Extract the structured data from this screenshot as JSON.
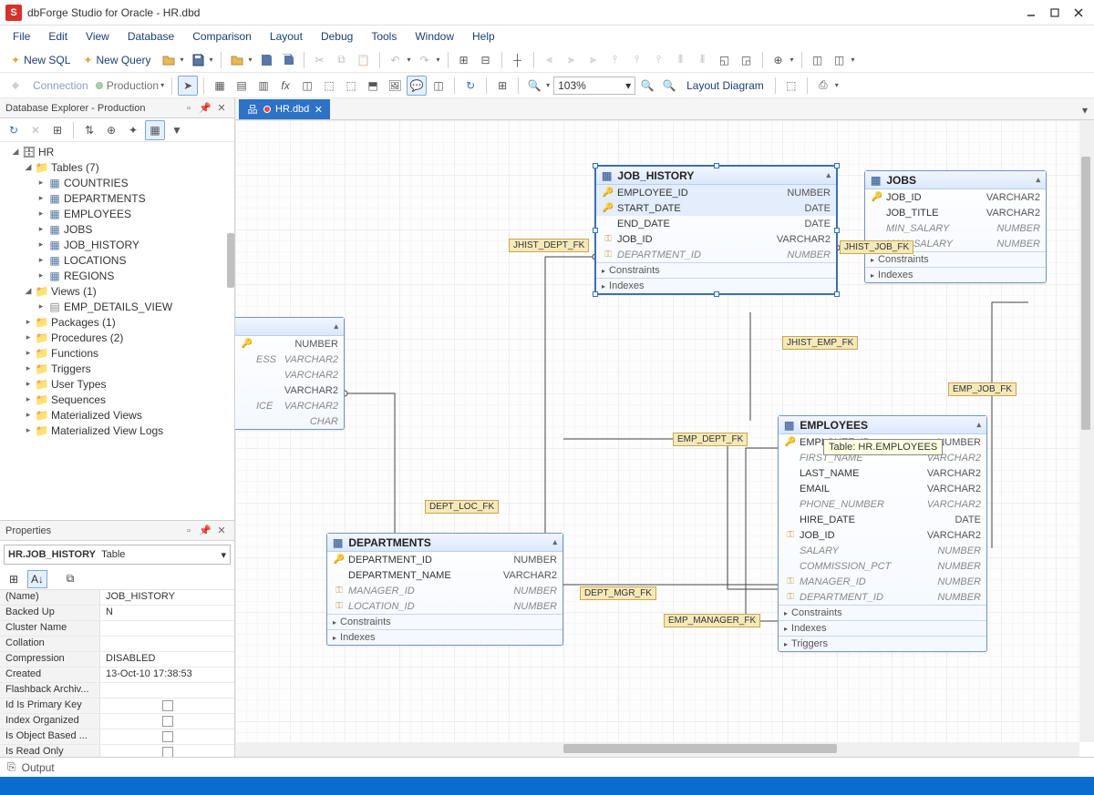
{
  "titlebar": {
    "title": "dbForge Studio for Oracle - HR.dbd"
  },
  "menu": [
    "File",
    "Edit",
    "View",
    "Database",
    "Comparison",
    "Layout",
    "Debug",
    "Tools",
    "Window",
    "Help"
  ],
  "toolbar1": {
    "newSql": "New SQL",
    "newQuery": "New Query"
  },
  "toolbar2": {
    "connection": "Connection",
    "production": "Production",
    "zoom": "103%",
    "layout": "Layout Diagram"
  },
  "dbExplorer": {
    "title": "Database Explorer - Production",
    "root": "HR",
    "tablesFolder": "Tables (7)",
    "tables": [
      "COUNTRIES",
      "DEPARTMENTS",
      "EMPLOYEES",
      "JOBS",
      "JOB_HISTORY",
      "LOCATIONS",
      "REGIONS"
    ],
    "viewsFolder": "Views (1)",
    "views": [
      "EMP_DETAILS_VIEW"
    ],
    "folders": [
      "Packages (1)",
      "Procedures (2)",
      "Functions",
      "Triggers",
      "User Types",
      "Sequences",
      "Materialized Views",
      "Materialized View Logs"
    ]
  },
  "properties": {
    "title": "Properties",
    "obj_name": "HR.JOB_HISTORY",
    "obj_type": "Table",
    "rows": [
      {
        "k": "(Name)",
        "v": "JOB_HISTORY"
      },
      {
        "k": "Backed Up",
        "v": "N"
      },
      {
        "k": "Cluster Name",
        "v": ""
      },
      {
        "k": "Collation",
        "v": ""
      },
      {
        "k": "Compression",
        "v": "DISABLED"
      },
      {
        "k": "Created",
        "v": "13-Oct-10 17:38:53"
      },
      {
        "k": "Flashback Archiv...",
        "v": ""
      },
      {
        "k": "Id Is Primary Key",
        "v": "[chk]"
      },
      {
        "k": "Index Organized",
        "v": "[chk]"
      },
      {
        "k": "Is Object Based ...",
        "v": "[chk]"
      },
      {
        "k": "Is Read Only",
        "v": "[chk]"
      }
    ]
  },
  "tab": {
    "label": "HR.dbd"
  },
  "tooltip": "Table: HR.EMPLOYEES",
  "entities": {
    "partial": {
      "cols": [
        {
          "n": "",
          "t": "NUMBER",
          "key": "pk"
        },
        {
          "n": "ESS",
          "t": "VARCHAR2",
          "null": true
        },
        {
          "n": "",
          "t": "VARCHAR2",
          "null": true
        },
        {
          "n": "",
          "t": "VARCHAR2"
        },
        {
          "n": "ICE",
          "t": "VARCHAR2",
          "null": true
        },
        {
          "n": "",
          "t": "CHAR",
          "null": true
        }
      ]
    },
    "job_history": {
      "name": "JOB_HISTORY",
      "cols": [
        {
          "n": "EMPLOYEE_ID",
          "t": "NUMBER",
          "key": "pk"
        },
        {
          "n": "START_DATE",
          "t": "DATE",
          "key": "pk"
        },
        {
          "n": "END_DATE",
          "t": "DATE"
        },
        {
          "n": "JOB_ID",
          "t": "VARCHAR2",
          "key": "fk"
        },
        {
          "n": "DEPARTMENT_ID",
          "t": "NUMBER",
          "key": "fk",
          "null": true
        }
      ],
      "sections": [
        "Constraints",
        "Indexes"
      ]
    },
    "jobs": {
      "name": "JOBS",
      "cols": [
        {
          "n": "JOB_ID",
          "t": "VARCHAR2",
          "key": "pk"
        },
        {
          "n": "JOB_TITLE",
          "t": "VARCHAR2"
        },
        {
          "n": "MIN_SALARY",
          "t": "NUMBER",
          "null": true
        },
        {
          "n": "MAX_SALARY",
          "t": "NUMBER",
          "null": true
        }
      ],
      "sections": [
        "Constraints",
        "Indexes"
      ]
    },
    "departments": {
      "name": "DEPARTMENTS",
      "cols": [
        {
          "n": "DEPARTMENT_ID",
          "t": "NUMBER",
          "key": "pk"
        },
        {
          "n": "DEPARTMENT_NAME",
          "t": "VARCHAR2"
        },
        {
          "n": "MANAGER_ID",
          "t": "NUMBER",
          "key": "fk",
          "null": true
        },
        {
          "n": "LOCATION_ID",
          "t": "NUMBER",
          "key": "fk",
          "null": true
        }
      ],
      "sections": [
        "Constraints",
        "Indexes"
      ]
    },
    "employees": {
      "name": "EMPLOYEES",
      "cols": [
        {
          "n": "EMPLOYEE_ID",
          "t": "NUMBER",
          "key": "pk"
        },
        {
          "n": "FIRST_NAME",
          "t": "VARCHAR2",
          "null": true
        },
        {
          "n": "LAST_NAME",
          "t": "VARCHAR2"
        },
        {
          "n": "EMAIL",
          "t": "VARCHAR2"
        },
        {
          "n": "PHONE_NUMBER",
          "t": "VARCHAR2",
          "null": true
        },
        {
          "n": "HIRE_DATE",
          "t": "DATE"
        },
        {
          "n": "JOB_ID",
          "t": "VARCHAR2",
          "key": "fk"
        },
        {
          "n": "SALARY",
          "t": "NUMBER",
          "null": true
        },
        {
          "n": "COMMISSION_PCT",
          "t": "NUMBER",
          "null": true
        },
        {
          "n": "MANAGER_ID",
          "t": "NUMBER",
          "key": "fk",
          "null": true
        },
        {
          "n": "DEPARTMENT_ID",
          "t": "NUMBER",
          "key": "fk",
          "null": true
        }
      ],
      "sections": [
        "Constraints",
        "Indexes",
        "Triggers"
      ]
    }
  },
  "relations": {
    "jhist_dept": "JHIST_DEPT_FK",
    "jhist_job": "JHIST_JOB_FK",
    "jhist_emp": "JHIST_EMP_FK",
    "emp_job": "EMP_JOB_FK",
    "emp_dept": "EMP_DEPT_FK",
    "emp_manager": "EMP_MANAGER_FK",
    "dept_mgr": "DEPT_MGR_FK",
    "dept_loc": "DEPT_LOC_FK"
  },
  "output": {
    "label": "Output"
  }
}
